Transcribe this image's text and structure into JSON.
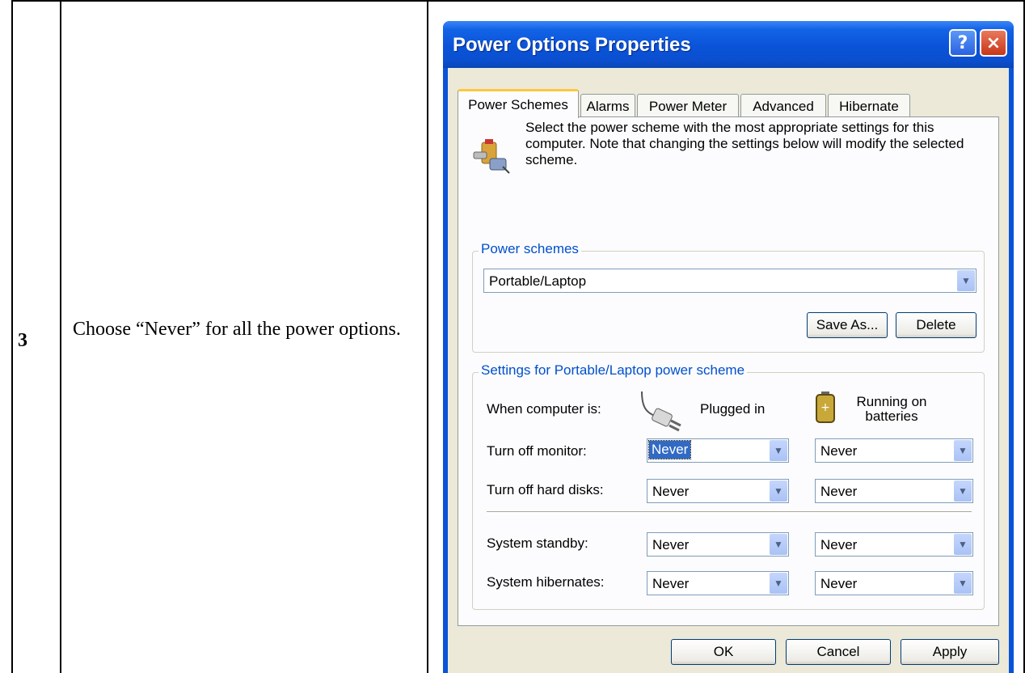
{
  "step": {
    "number": "3",
    "instruction": "Choose “Never” for all the power options."
  },
  "dialog": {
    "title": "Power Options Properties",
    "help_label": "?",
    "close_label": "×",
    "tabs": [
      {
        "label": "Power Schemes",
        "active": true
      },
      {
        "label": "Alarms",
        "active": false
      },
      {
        "label": "Power Meter",
        "active": false
      },
      {
        "label": "Advanced",
        "active": false
      },
      {
        "label": "Hibernate",
        "active": false
      }
    ],
    "intro_text": "Select the power scheme with the most appropriate settings for this computer. Note that changing the settings below will modify the selected scheme.",
    "schemes_group": {
      "title": "Power schemes",
      "selected_scheme": "Portable/Laptop",
      "save_as_label": "Save As...",
      "delete_label": "Delete"
    },
    "settings_group": {
      "title": "Settings for Portable/Laptop power scheme",
      "when_label": "When computer is:",
      "plugged_in_label": "Plugged in",
      "batteries_label": "Running on batteries",
      "rows": [
        {
          "label": "Turn off monitor:",
          "plugged": "Never",
          "battery": "Never"
        },
        {
          "label": "Turn off hard disks:",
          "plugged": "Never",
          "battery": "Never"
        },
        {
          "label": "System standby:",
          "plugged": "Never",
          "battery": "Never"
        },
        {
          "label": "System hibernates:",
          "plugged": "Never",
          "battery": "Never"
        }
      ]
    },
    "ok_label": "OK",
    "cancel_label": "Cancel",
    "apply_label": "Apply"
  }
}
